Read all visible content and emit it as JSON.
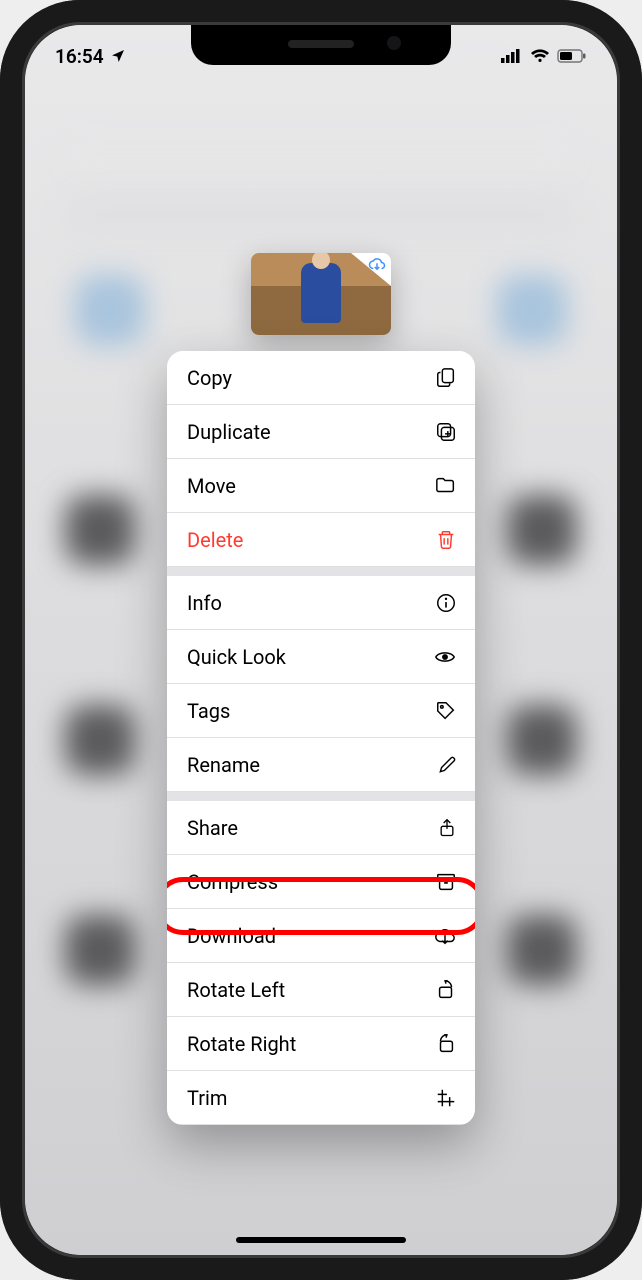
{
  "status": {
    "time": "16:54",
    "location_arrow": "location-arrow-icon"
  },
  "menu": {
    "groups": [
      [
        {
          "id": "copy",
          "label": "Copy",
          "icon": "copy-icon"
        },
        {
          "id": "duplicate",
          "label": "Duplicate",
          "icon": "duplicate-icon"
        },
        {
          "id": "move",
          "label": "Move",
          "icon": "folder-icon"
        },
        {
          "id": "delete",
          "label": "Delete",
          "icon": "trash-icon",
          "destructive": true
        }
      ],
      [
        {
          "id": "info",
          "label": "Info",
          "icon": "info-icon"
        },
        {
          "id": "quicklook",
          "label": "Quick Look",
          "icon": "eye-icon"
        },
        {
          "id": "tags",
          "label": "Tags",
          "icon": "tag-icon"
        },
        {
          "id": "rename",
          "label": "Rename",
          "icon": "pencil-icon"
        }
      ],
      [
        {
          "id": "share",
          "label": "Share",
          "icon": "share-icon"
        },
        {
          "id": "compress",
          "label": "Compress",
          "icon": "archive-icon",
          "highlighted": true
        },
        {
          "id": "download",
          "label": "Download",
          "icon": "cloud-download-icon"
        },
        {
          "id": "rotate-left",
          "label": "Rotate Left",
          "icon": "rotate-left-icon"
        },
        {
          "id": "rotate-right",
          "label": "Rotate Right",
          "icon": "rotate-right-icon"
        },
        {
          "id": "trim",
          "label": "Trim",
          "icon": "trim-icon"
        }
      ]
    ]
  }
}
